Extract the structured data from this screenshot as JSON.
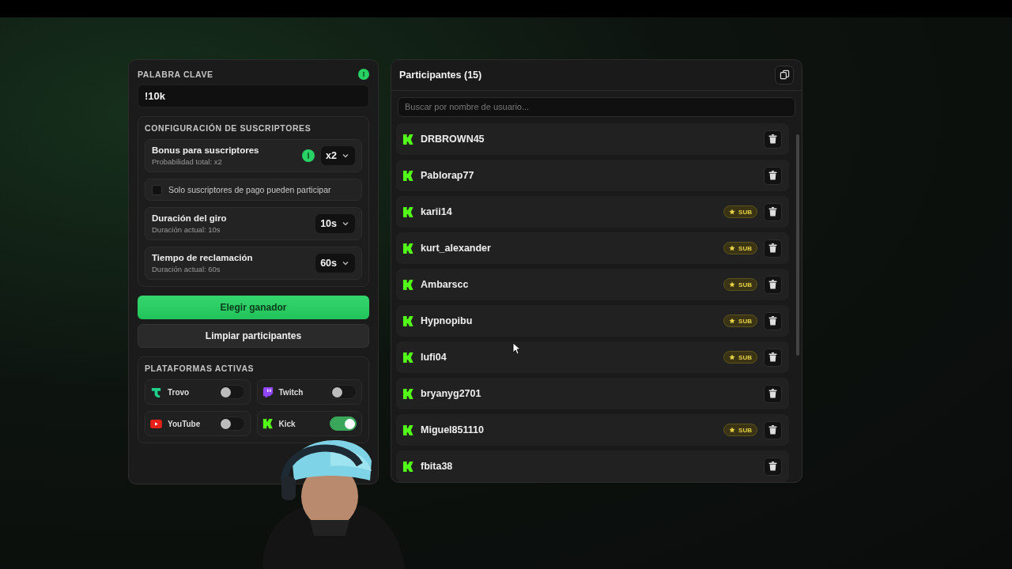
{
  "keyword": {
    "label": "PALABRA CLAVE",
    "value": "!10k"
  },
  "subscriber_config": {
    "title": "CONFIGURACIÓN DE SUSCRIPTORES",
    "bonus": {
      "label": "Bonus para suscriptores",
      "sub": "Probabilidad total: x2",
      "value": "x2"
    },
    "paid_only": {
      "label": "Solo suscriptores de pago pueden participar",
      "checked": false
    },
    "spin_duration": {
      "label": "Duración del giro",
      "sub": "Duración actual: 10s",
      "value": "10s"
    },
    "claim_time": {
      "label": "Tiempo de reclamación",
      "sub": "Duración actual: 60s",
      "value": "60s"
    }
  },
  "buttons": [
    {
      "label": "Elegir ganador",
      "kind": "primary"
    },
    {
      "label": "Limpiar participantes",
      "kind": "secondary"
    }
  ],
  "platforms": {
    "title": "PLATAFORMAS ACTIVAS",
    "items": [
      {
        "name": "Trovo",
        "kind": "trovo",
        "on": false
      },
      {
        "name": "Twitch",
        "kind": "twitch",
        "on": false
      },
      {
        "name": "YouTube",
        "kind": "youtube",
        "on": false
      },
      {
        "name": "Kick",
        "kind": "kick",
        "on": true
      }
    ]
  },
  "participants": {
    "title": "Participantes (15)",
    "search": {
      "placeholder": "Buscar por nombre de usuario..."
    },
    "rows": [
      {
        "name": "DRBROWN45"
      },
      {
        "name": "Pablorap77"
      },
      {
        "name": "karii14",
        "badge": "SUB"
      },
      {
        "name": "kurt_alexander",
        "badge": "SUB"
      },
      {
        "name": "Ambarscc",
        "badge": "SUB"
      },
      {
        "name": "Hypnopibu",
        "badge": "SUB"
      },
      {
        "name": "lufi04",
        "badge": "SUB"
      },
      {
        "name": "bryanyg2701"
      },
      {
        "name": "Miguel851110",
        "badge": "SUB"
      },
      {
        "name": "fbita38"
      }
    ]
  }
}
